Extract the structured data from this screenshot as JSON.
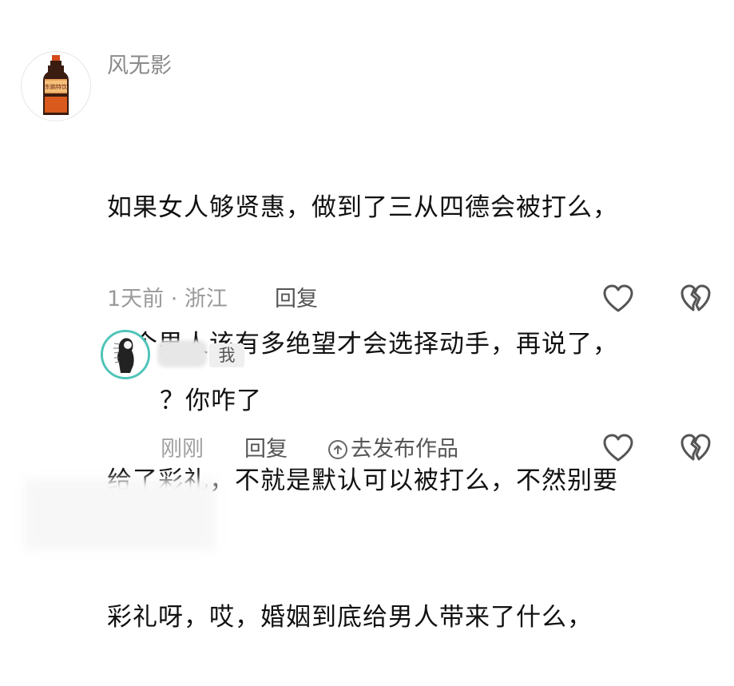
{
  "comment": {
    "username": "风无影",
    "text_lines": [
      "如果女人够贤惠，做到了三从四德会被打么，",
      "一个男人该有多绝望才会选择动手，再说了，",
      "给了彩礼，不就是默认可以被打么，不然别要",
      "彩礼呀，哎，婚姻到底给男人带来了什么，"
    ],
    "meta": "1天前 · 浙江",
    "reply_label": "回复",
    "avatar_bottle_text": "东鹏特饮"
  },
  "reply": {
    "badge": "我",
    "text": "？你咋了",
    "time": "刚刚",
    "reply_label": "回复",
    "publish_label": "去发布作品"
  },
  "colors": {
    "avatar_ring": "#4fc4b8",
    "meta_gray": "#9a9a9a",
    "text": "#111111"
  }
}
